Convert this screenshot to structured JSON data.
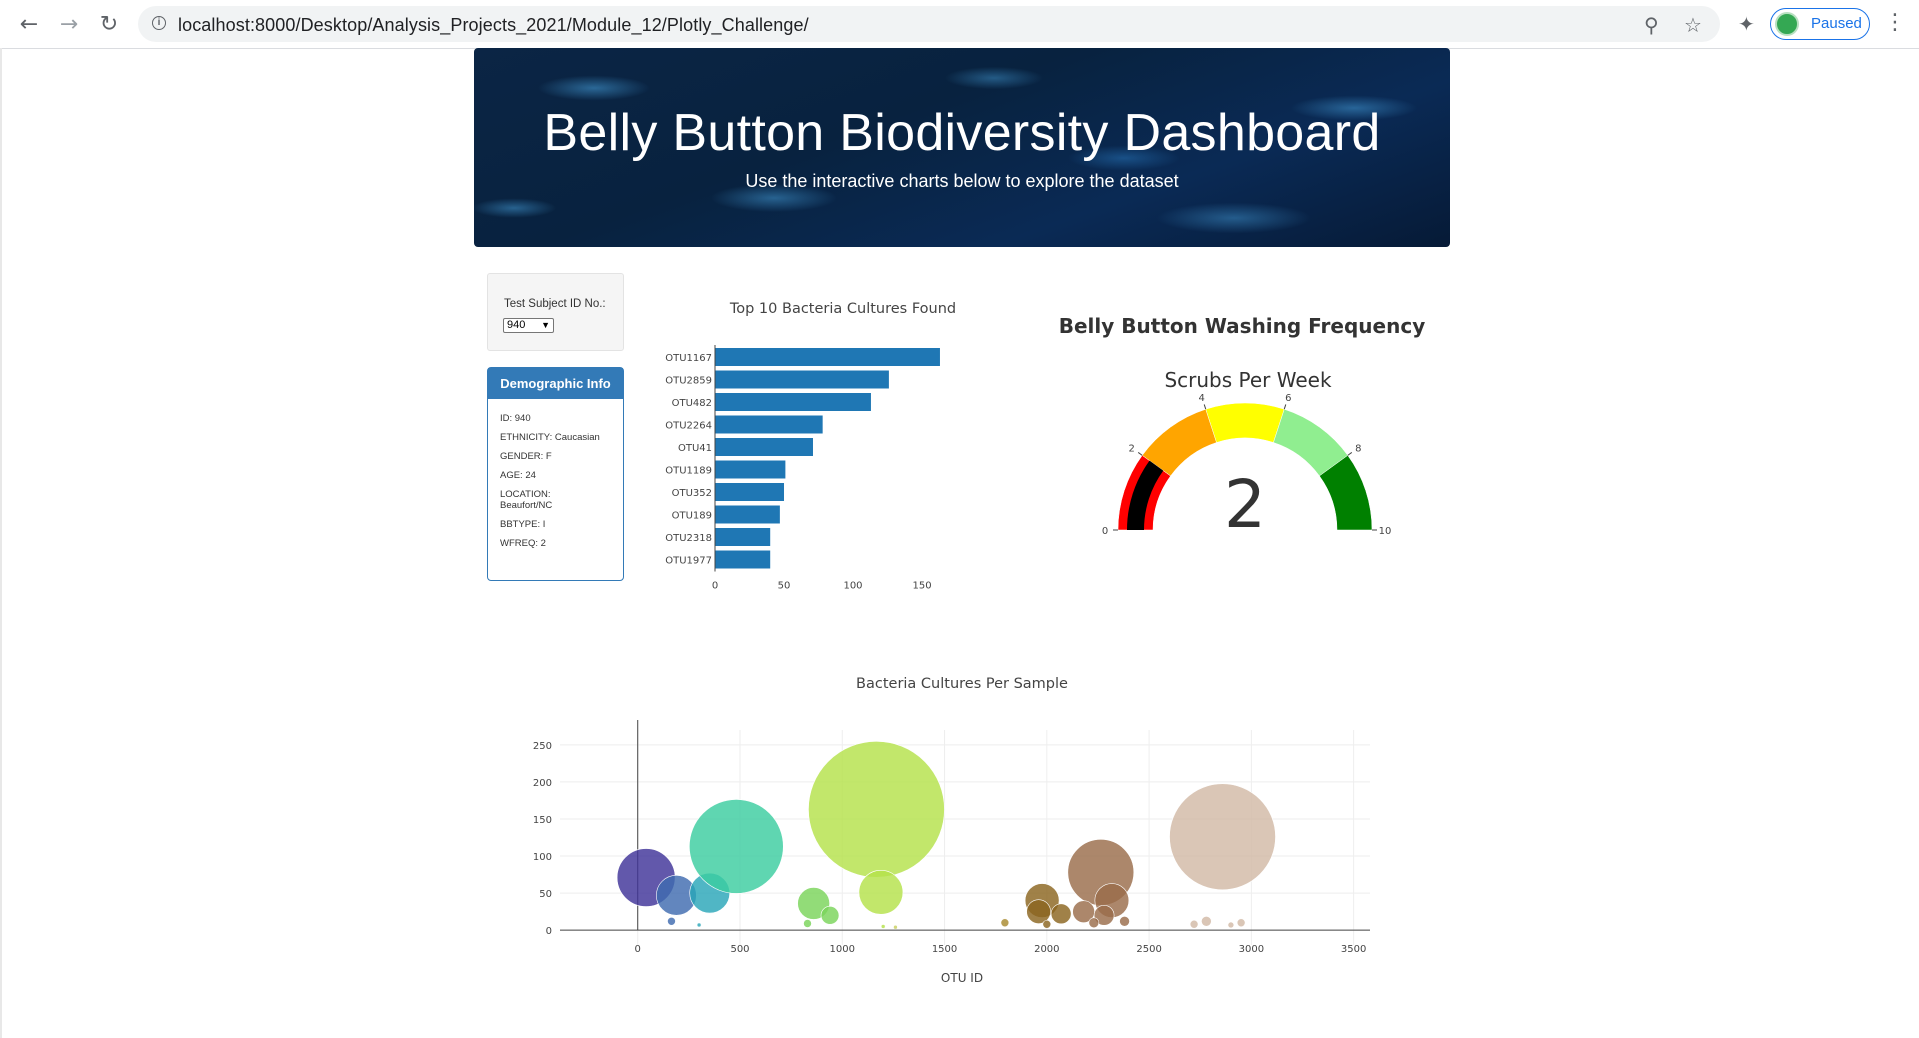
{
  "browser": {
    "back_icon": "arrow-left-icon",
    "forward_icon": "arrow-right-icon",
    "reload_icon": "reload-icon",
    "url": "localhost:8000/Desktop/Analysis_Projects_2021/Module_12/Plotly_Challenge/",
    "profile_label": "Paused"
  },
  "header": {
    "title": "Belly Button Biodiversity Dashboard",
    "subtitle": "Use the interactive charts below to explore the dataset"
  },
  "selector": {
    "label": "Test Subject ID No.:",
    "selected": "940"
  },
  "demographics": {
    "heading": "Demographic Info",
    "lines": [
      "ID: 940",
      "ETHNICITY: Caucasian",
      "GENDER: F",
      "AGE: 24",
      "LOCATION: Beaufort/NC",
      "BBTYPE: I",
      "WFREQ: 2"
    ]
  },
  "colors": {
    "bar": "#1f77b4",
    "panel_primary": "#337ab7",
    "gauge_bands": [
      "#000000",
      "#ff0000",
      "#ffa500",
      "#ffff00",
      "#90ee90",
      "#008000"
    ]
  },
  "chart_data": [
    {
      "type": "bar",
      "orientation": "horizontal",
      "title": "Top 10 Bacteria Cultures Found",
      "categories": [
        "OTU1167",
        "OTU2859",
        "OTU482",
        "OTU2264",
        "OTU41",
        "OTU1189",
        "OTU352",
        "OTU189",
        "OTU2318",
        "OTU1977"
      ],
      "values": [
        163,
        126,
        113,
        78,
        71,
        51,
        50,
        47,
        40,
        40
      ],
      "xticks": [
        "0",
        "50",
        "100",
        "150"
      ],
      "xlim": [
        0,
        171
      ]
    },
    {
      "type": "gauge",
      "title": "Belly Button Washing Frequency",
      "subtitle": "Scrubs Per Week",
      "value": 2,
      "display_value": "2",
      "range": [
        0,
        10
      ],
      "ticks": [
        "0",
        "2",
        "4",
        "6",
        "8",
        "10"
      ],
      "steps": [
        {
          "range": [
            0,
            2
          ],
          "color": "#ff0000"
        },
        {
          "range": [
            2,
            4
          ],
          "color": "#ffa500"
        },
        {
          "range": [
            4,
            6
          ],
          "color": "#ffff00"
        },
        {
          "range": [
            6,
            8
          ],
          "color": "#90ee90"
        },
        {
          "range": [
            8,
            10
          ],
          "color": "#008000"
        }
      ],
      "bar_color": "#000000"
    },
    {
      "type": "scatter",
      "mode": "bubble",
      "title": "Bacteria Cultures Per Sample",
      "xlabel": "OTU ID",
      "xlim": [
        -380,
        3580
      ],
      "ylim": [
        -20,
        270
      ],
      "xticks": [
        "0",
        "500",
        "1000",
        "1500",
        "2000",
        "2500",
        "3000",
        "3500"
      ],
      "yticks": [
        "0",
        "50",
        "100",
        "150",
        "200",
        "250"
      ],
      "points": [
        {
          "x": 41,
          "y": 71,
          "r": 29,
          "color": "#3f3399"
        },
        {
          "x": 189,
          "y": 47,
          "r": 20,
          "color": "#3f6bb0"
        },
        {
          "x": 165,
          "y": 12,
          "r": 4,
          "color": "#3f6bb0"
        },
        {
          "x": 352,
          "y": 50,
          "r": 20,
          "color": "#2aa6b8"
        },
        {
          "x": 300,
          "y": 7,
          "r": 2,
          "color": "#2aa6b8"
        },
        {
          "x": 482,
          "y": 113,
          "r": 47,
          "color": "#3ccda0"
        },
        {
          "x": 860,
          "y": 36,
          "r": 16,
          "color": "#7ad45a"
        },
        {
          "x": 940,
          "y": 20,
          "r": 9,
          "color": "#7ad45a"
        },
        {
          "x": 830,
          "y": 9,
          "r": 4,
          "color": "#7ad45a"
        },
        {
          "x": 1167,
          "y": 163,
          "r": 68,
          "color": "#b5e24a"
        },
        {
          "x": 1189,
          "y": 51,
          "r": 22,
          "color": "#b5e24a"
        },
        {
          "x": 1200,
          "y": 5,
          "r": 2,
          "color": "#b5e24a"
        },
        {
          "x": 1260,
          "y": 4,
          "r": 2,
          "color": "#c9d060"
        },
        {
          "x": 1795,
          "y": 10,
          "r": 4,
          "color": "#a88a30"
        },
        {
          "x": 1977,
          "y": 40,
          "r": 17,
          "color": "#8b6520"
        },
        {
          "x": 1960,
          "y": 25,
          "r": 12,
          "color": "#8b6520"
        },
        {
          "x": 2070,
          "y": 22,
          "r": 10,
          "color": "#8b6520"
        },
        {
          "x": 2000,
          "y": 8,
          "r": 4,
          "color": "#8b6520"
        },
        {
          "x": 2264,
          "y": 78,
          "r": 33,
          "color": "#9a6d4a"
        },
        {
          "x": 2318,
          "y": 40,
          "r": 17,
          "color": "#9a6d4a"
        },
        {
          "x": 2180,
          "y": 25,
          "r": 11,
          "color": "#9a6d4a"
        },
        {
          "x": 2280,
          "y": 20,
          "r": 10,
          "color": "#9a6d4a"
        },
        {
          "x": 2230,
          "y": 10,
          "r": 5,
          "color": "#9a6d4a"
        },
        {
          "x": 2380,
          "y": 12,
          "r": 5,
          "color": "#9a6d4a"
        },
        {
          "x": 2859,
          "y": 126,
          "r": 53,
          "color": "#d2baa6"
        },
        {
          "x": 2780,
          "y": 12,
          "r": 5,
          "color": "#d2baa6"
        },
        {
          "x": 2720,
          "y": 8,
          "r": 4,
          "color": "#d2baa6"
        },
        {
          "x": 2900,
          "y": 7,
          "r": 3,
          "color": "#d2baa6"
        },
        {
          "x": 2950,
          "y": 10,
          "r": 4,
          "color": "#d2baa6"
        }
      ]
    }
  ]
}
